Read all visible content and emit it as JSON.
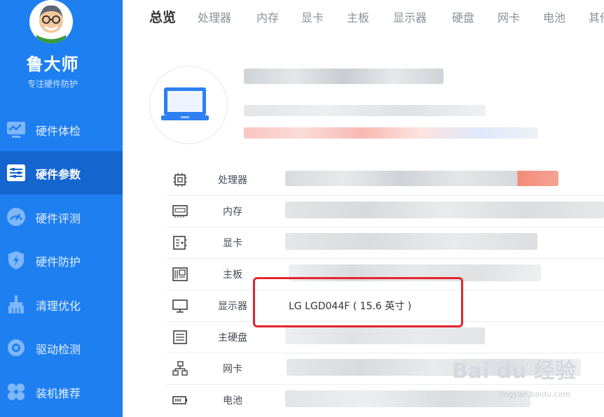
{
  "brand": {
    "name": "鲁大师",
    "slogan": "专注硬件防护"
  },
  "sidebar": {
    "items": [
      {
        "label": "硬件体检",
        "icon": "monitor-check-icon",
        "active": false
      },
      {
        "label": "硬件参数",
        "icon": "sliders-icon",
        "active": true
      },
      {
        "label": "硬件评测",
        "icon": "gauge-icon",
        "active": false
      },
      {
        "label": "硬件防护",
        "icon": "shield-icon",
        "active": false
      },
      {
        "label": "清理优化",
        "icon": "broom-icon",
        "active": false
      },
      {
        "label": "驱动检测",
        "icon": "gear-icon",
        "active": false
      },
      {
        "label": "装机推荐",
        "icon": "puzzle-icon",
        "active": false
      }
    ]
  },
  "tabs": [
    "总览",
    "处理器",
    "内存",
    "显卡",
    "主板",
    "显示器",
    "硬盘",
    "网卡",
    "电池",
    "其他"
  ],
  "rows": [
    {
      "label": "处理器",
      "value": "",
      "icon": "cpu-icon"
    },
    {
      "label": "内存",
      "value": "",
      "icon": "memory-icon"
    },
    {
      "label": "显卡",
      "value": "",
      "icon": "graphics-card-icon"
    },
    {
      "label": "主板",
      "value": "",
      "icon": "motherboard-icon"
    },
    {
      "label": "显示器",
      "value": "LG LGD044F ( 15.6 英寸 )",
      "icon": "monitor-icon"
    },
    {
      "label": "主硬盘",
      "value": "",
      "icon": "hard-disk-icon"
    },
    {
      "label": "网卡",
      "value": "",
      "icon": "network-icon"
    },
    {
      "label": "电池",
      "value": "",
      "icon": "battery-icon"
    }
  ],
  "watermark": {
    "logo": "Bai du 经验",
    "url": "jingyan.baidu.com"
  },
  "colors": {
    "sidebar": "#1e7ff0",
    "sidebar_active": "#1565cf",
    "highlight": "#e0262e"
  }
}
